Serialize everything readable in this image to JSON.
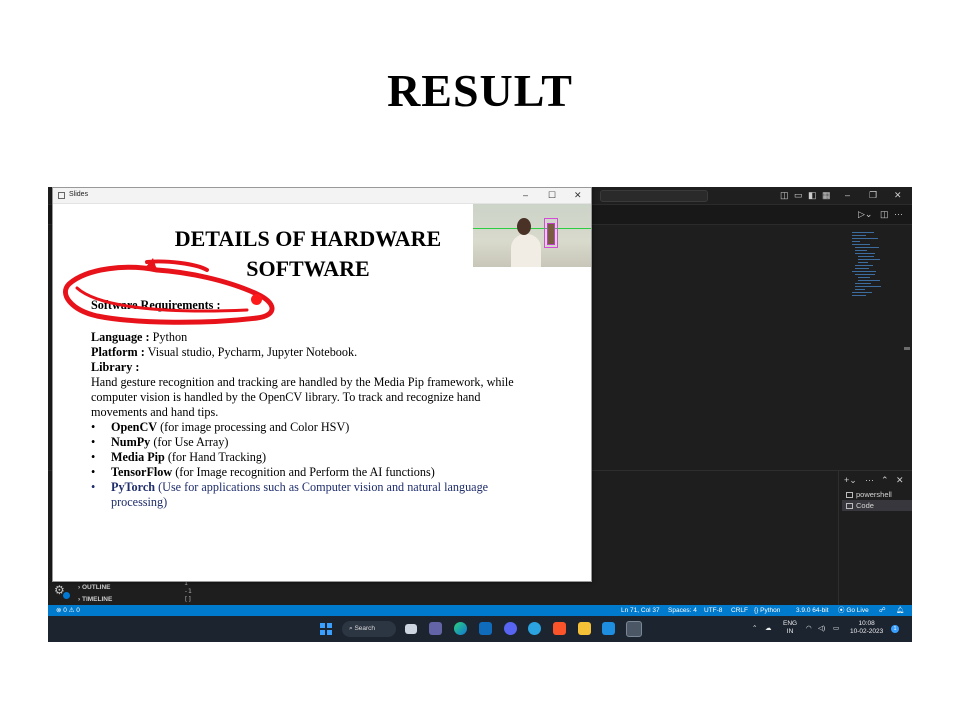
{
  "slide": {
    "title": "RESULT"
  },
  "vscode": {
    "outline_label": "OUTLINE",
    "timeline_label": "TIMELINE",
    "terminals": [
      "powershell",
      "Code"
    ],
    "terminal_numbers": [
      "1",
      "-1",
      "[]"
    ],
    "status": {
      "errors": "⊗ 0 ⚠ 0",
      "position": "Ln 71, Col 37",
      "spaces": "Spaces: 4",
      "encoding": "UTF-8",
      "eol": "CRLF",
      "language": "Python",
      "interpreter": "3.9.0 64-bit",
      "golive": "Go Live"
    },
    "accent": "#007acc"
  },
  "slides_window": {
    "title": "Slides",
    "heading_line1": "DETAILS OF HARDWARE",
    "heading_line2": "SOFTWARE",
    "software_requirements": "Software Requirements :",
    "language_label": "Language :",
    "language_value": "Python",
    "platform_label": "Platform :",
    "platform_value": "Visual studio, Pycharm, Jupyter Notebook.",
    "library_label": "Library :",
    "library_desc_1": "Hand gesture recognition and tracking are handled by the Media Pip framework, while",
    "library_desc_2": "computer vision is handled by the OpenCV library. To track and recognize hand",
    "library_desc_3": "movements and hand tips.",
    "bullets": [
      {
        "name": "OpenCV",
        "desc": "(for image processing and Color HSV)"
      },
      {
        "name": "NumPy",
        "desc": "(for Use Array)"
      },
      {
        "name": "Media Pip",
        "desc": "(for Hand Tracking)"
      },
      {
        "name": "TensorFlow",
        "desc": "(for Image recognition and Perform the AI functions)"
      },
      {
        "name": "PyTorch",
        "desc": "(Use for applications such as Computer vision and natural language"
      }
    ],
    "pytorch_cont": "processing)"
  },
  "taskbar": {
    "search_label": "Search",
    "lang_line1": "ENG",
    "lang_line2": "IN",
    "time": "10:08",
    "date": "10-02-2023",
    "notification_count": "1"
  }
}
